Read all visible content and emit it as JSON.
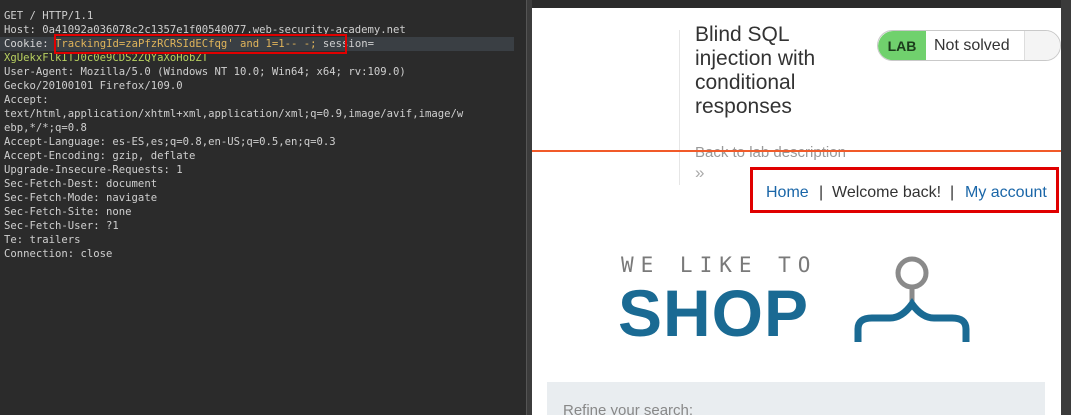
{
  "request": {
    "lines": [
      "GET / HTTP/1.1",
      "Host: 0a41092a036078c2c1357e1f00540077.web-security-academy.net",
      "",
      "XgUekxFlkITJ0c0e9CDS2ZQYaXoHobZT",
      "User-Agent: Mozilla/5.0 (Windows NT 10.0; Win64; x64; rv:109.0)",
      "Gecko/20100101 Firefox/109.0",
      "Accept:",
      "text/html,application/xhtml+xml,application/xml;q=0.9,image/avif,image/w",
      "ebp,*/*;q=0.8",
      "Accept-Language: es-ES,es;q=0.8,en-US;q=0.5,en;q=0.3",
      "Accept-Encoding: gzip, deflate",
      "Upgrade-Insecure-Requests: 1",
      "Sec-Fetch-Dest: document",
      "Sec-Fetch-Mode: navigate",
      "Sec-Fetch-Site: none",
      "Sec-Fetch-User: ?1",
      "Te: trailers",
      "Connection: close"
    ],
    "cookie_name": "Cookie:",
    "cookie_tracking": "TrackingId=zaPfzRCRSIdECfqg' and 1=1-- -;",
    "cookie_session": " session="
  },
  "lab": {
    "title": "Blind SQL injection with conditional responses",
    "badge": "LAB",
    "status": "Not solved",
    "back_link": "Back to lab description",
    "back_chevron": "»"
  },
  "nav": {
    "home": "Home",
    "sep": "|",
    "welcome": "Welcome back!",
    "account": "My account"
  },
  "logo": {
    "tagline": "WE LIKE TO",
    "word": "SHOP"
  },
  "search": {
    "label": "Refine your search:"
  },
  "colors": {
    "accent_orange": "#f15a29",
    "lab_green": "#70d16d",
    "link_blue": "#1a66a8",
    "logo_blue": "#1a6a93",
    "highlight_red": "#e00000"
  }
}
